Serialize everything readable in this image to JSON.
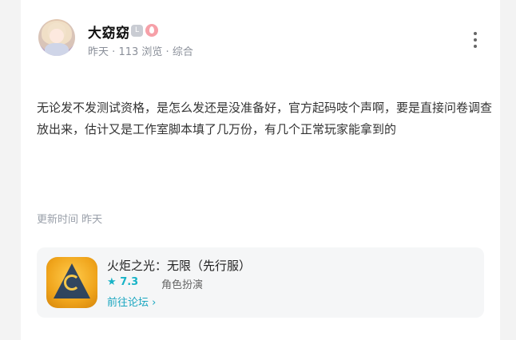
{
  "post": {
    "author": "大窈窈",
    "level_badge": "L",
    "time": "昨天",
    "views": "113 浏览",
    "category": "综合",
    "separator": "·",
    "content": "无论发不发测试资格，是怎么发还是没准备好，官方起码吱个声啊，要是直接问卷调查放出来，估计又是工作室脚本填了几万份，有几个正常玩家能拿到的",
    "updated_label": "更新时间",
    "updated_time": "昨天"
  },
  "game": {
    "title": "火炬之光：无限（先行服）",
    "star_icon": "star-icon",
    "rating": "7.3",
    "genre": "角色扮演",
    "forum_link": "前往论坛",
    "forum_arrow": "chevron-right-icon"
  }
}
